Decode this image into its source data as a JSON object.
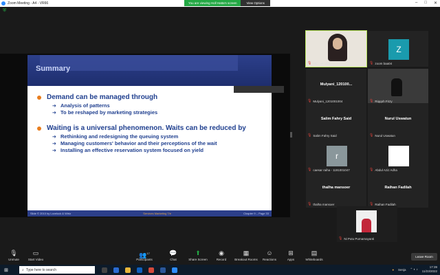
{
  "window": {
    "title": "Zoom Meeting - A4 - VR66",
    "viewing_banner": "You are viewing Holl Hatta's screen",
    "view_options": "View Options",
    "controls": [
      "–",
      "□",
      "✕"
    ]
  },
  "slide": {
    "title": "Summary",
    "bullets": [
      {
        "text": "Demand can be managed through",
        "subs": [
          "Analysis of patterns",
          "To be reshaped by marketing strategies"
        ]
      },
      {
        "text": "Waiting is a universal phenomenon. Waits can be reduced by",
        "subs": [
          "Rethinking and redesigning the queuing system",
          "Managing customers' behavior and their perceptions of the wait",
          "Installing an effective reservation system focused on yield"
        ]
      }
    ],
    "footer_left": "Slide © 2010 by Lovelock & Wirtz",
    "footer_mid": "Services Marketing 7/e",
    "footer_right": "Chapter 9 – Page 33"
  },
  "participants": [
    {
      "name_label": "HC - ••• citra",
      "type": "video-1",
      "active": true
    },
    {
      "name_label": "zoom baa04",
      "avatar": "Z",
      "avatar_color": "#1a9bad"
    },
    {
      "center_name": "Mulyani_120100...",
      "name_label": "Mulyani_1201001004"
    },
    {
      "name_label": "Riqqoh Firzy",
      "type": "video-2"
    },
    {
      "center_name": "Salim Fahry Said",
      "name_label": "Salim Fahry Said"
    },
    {
      "center_name": "Nurul Uswatun",
      "name_label": "Nurul Uswatun"
    },
    {
      "name_label": "caesar raiha - 1191001047",
      "avatar": "r",
      "avatar_color": "#8a979b"
    },
    {
      "name_label": "Abdul Aziz Adha",
      "type": "logo"
    },
    {
      "center_name": "thalha mansoer",
      "name_label": "thalha mansoer"
    },
    {
      "center_name": "Raihan Fadilah",
      "name_label": "Raihan Fadilah"
    },
    {
      "name_label": "Ni Putu Purnamayanti",
      "type": "video-3"
    }
  ],
  "toolbar": {
    "unmute": "Unmute",
    "start_video": "Start Video",
    "participants": "Participants",
    "participants_count": "17",
    "chat": "Chat",
    "share": "Share Screen",
    "record": "Record",
    "breakout": "Breakout Rooms",
    "reactions": "Reactions",
    "apps": "Apps",
    "whiteboards": "Whiteboards",
    "leave": "Leave Room"
  },
  "taskbar": {
    "search_placeholder": "Type here to search",
    "weather": "Senja",
    "time": "17:39",
    "date": "11/23/2022"
  }
}
